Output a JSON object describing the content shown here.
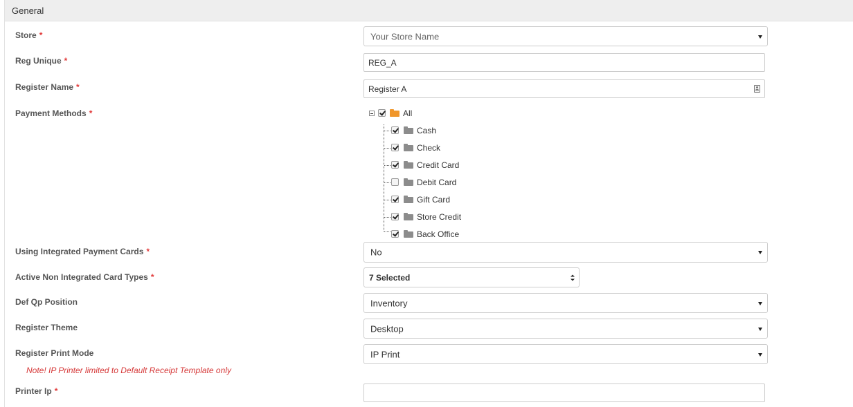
{
  "section": {
    "title": "General"
  },
  "required_mark": "*",
  "fields": {
    "store": {
      "label": "Store",
      "value": "Your Store Name"
    },
    "reg_unique": {
      "label": "Reg Unique",
      "value": "REG_A"
    },
    "register_name": {
      "label": "Register Name",
      "value": "Register A"
    },
    "payment_methods": {
      "label": "Payment Methods",
      "root": {
        "label": "All",
        "checked": true
      },
      "items": [
        {
          "label": "Cash",
          "checked": true
        },
        {
          "label": "Check",
          "checked": true
        },
        {
          "label": "Credit Card",
          "checked": true
        },
        {
          "label": "Debit Card",
          "checked": false
        },
        {
          "label": "Gift Card",
          "checked": true
        },
        {
          "label": "Store Credit",
          "checked": true
        },
        {
          "label": "Back Office",
          "checked": true
        }
      ]
    },
    "using_integrated": {
      "label": "Using Integrated Payment Cards",
      "value": "No"
    },
    "active_non_integrated": {
      "label": "Active Non Integrated Card Types",
      "value": "7 Selected"
    },
    "def_qp_position": {
      "label": "Def Qp Position",
      "value": "Inventory"
    },
    "register_theme": {
      "label": "Register Theme",
      "value": "Desktop"
    },
    "register_print_mode": {
      "label": "Register Print Mode",
      "value": "IP Print",
      "note": "Note! IP Printer limited to Default Receipt Template only"
    },
    "printer_ip": {
      "label": "Printer Ip",
      "value": ""
    }
  },
  "icons": {
    "tree_root": "folder-open-icon",
    "tree_item": "folder-icon",
    "register_name_addon": "contact-card-icon"
  },
  "colors": {
    "required": "#e23b3b",
    "note": "#d63a3a",
    "folder_open": "#f0962a",
    "folder": "#8c8c8c"
  }
}
